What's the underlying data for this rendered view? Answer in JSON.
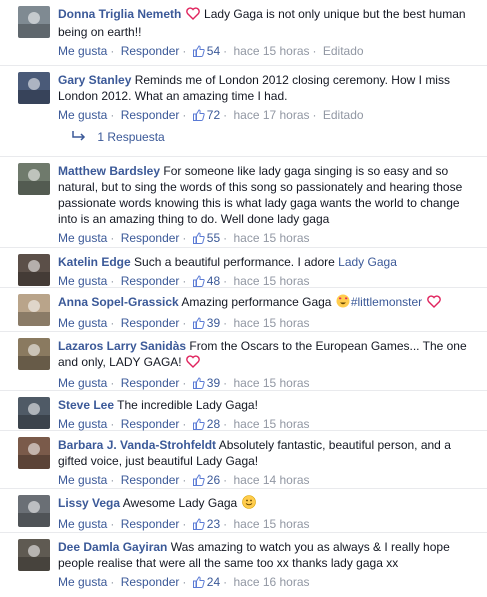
{
  "common": {
    "like_label": "Me gusta",
    "reply_label": "Responder",
    "edited_label": "Editado"
  },
  "comments": [
    {
      "author": "Donna Triglia Nemeth",
      "pre_text": "",
      "text": "Lady Gaga is not only unique but the best human being on earth!!",
      "link": "",
      "after_text": "",
      "likes": "54",
      "time": "hace 15 horas",
      "edited": true,
      "avatar_color": "#7f8a92",
      "emojis": [
        "heart-icon"
      ]
    },
    {
      "author": "Gary Stanley",
      "pre_text": "",
      "text": "Reminds me of London 2012 closing ceremony. How I miss London 2012. What an amazing time I had.",
      "link": "",
      "after_text": "",
      "likes": "72",
      "time": "hace 17 horas",
      "edited": true,
      "avatar_color": "#4a5a78",
      "emojis": []
    },
    {
      "author": "Matthew Bardsley",
      "pre_text": "",
      "text": "For someone like lady gaga singing is so easy and so natural, but to sing the words of this song so passionately and hearing those passionate words knowing this is what lady gaga wants the world to change into is an amazing thing to do. Well done lady gaga",
      "link": "",
      "after_text": "",
      "likes": "55",
      "time": "hace 15 horas",
      "edited": false,
      "avatar_color": "#6f7a6c",
      "emojis": []
    },
    {
      "author": "Katelin Edge",
      "pre_text": "",
      "text": "Such a beautiful performance. I adore ",
      "link": "Lady Gaga",
      "after_text": "",
      "likes": "48",
      "time": "hace 15 horas",
      "edited": false,
      "avatar_color": "#5b4f48",
      "emojis": []
    },
    {
      "author": "Anna Sopel-Grassick",
      "pre_text": "",
      "text": "Amazing performance Gaga ",
      "link": "#littlemonster",
      "after_text": "",
      "likes": "39",
      "time": "hace 15 horas",
      "edited": false,
      "avatar_color": "#b9a48a",
      "emojis": [
        "heart-eyes-emoji-icon",
        "heart-icon"
      ]
    },
    {
      "author": "Lazaros Larry Sanidàs",
      "pre_text": "",
      "text": "From the Oscars to the European Games... The one and only, LADY GAGA!",
      "link": "",
      "after_text": "",
      "likes": "39",
      "time": "hace 15 horas",
      "edited": false,
      "avatar_color": "#8a7a60",
      "emojis": [
        "heart-icon"
      ]
    },
    {
      "author": "Steve Lee",
      "pre_text": "",
      "text": "The incredible Lady Gaga!",
      "link": "",
      "after_text": "",
      "likes": "28",
      "time": "hace 15 horas",
      "edited": false,
      "avatar_color": "#4f5a66",
      "emojis": []
    },
    {
      "author": "Barbara J. Vanda-Strohfeldt",
      "pre_text": "",
      "text": "Absolutely fantastic, beautiful person, and a gifted voice, just beautiful Lady Gaga!",
      "link": "",
      "after_text": "",
      "likes": "26",
      "time": "hace 14 horas",
      "edited": false,
      "avatar_color": "#7a5a4a",
      "emojis": []
    },
    {
      "author": "Lissy Vega",
      "pre_text": "",
      "text": "Awesome Lady Gaga ",
      "link": "",
      "after_text": "",
      "likes": "23",
      "time": "hace 15 horas",
      "edited": false,
      "avatar_color": "#6a6f75",
      "emojis": [
        "smile-emoji-icon"
      ]
    },
    {
      "author": "Dee Damla Gayiran",
      "pre_text": "",
      "text": "Was amazing to watch you as always & I really hope people realise that were all the same too xx thanks lady gaga xx",
      "link": "",
      "after_text": "",
      "likes": "24",
      "time": "hace 16 horas",
      "edited": false,
      "avatar_color": "#5f5a52",
      "emojis": []
    }
  ],
  "reply": {
    "label": "1 Respuesta"
  }
}
